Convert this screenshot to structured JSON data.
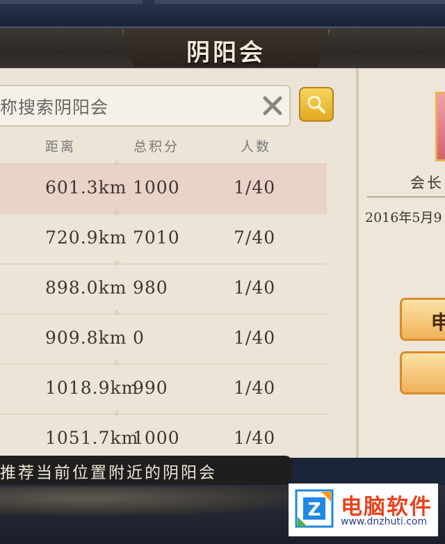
{
  "header": {
    "title": "阴阳会"
  },
  "search": {
    "text": "称搜索阴阳会"
  },
  "table": {
    "columns": [
      "距离",
      "总积分",
      "人数"
    ],
    "rows": [
      {
        "distance": "601.3km",
        "score": "1000",
        "members": "1/40"
      },
      {
        "distance": "720.9km",
        "score": "7010",
        "members": "7/40"
      },
      {
        "distance": "898.0km",
        "score": "980",
        "members": "1/40"
      },
      {
        "distance": "909.8km",
        "score": "0",
        "members": "1/40"
      },
      {
        "distance": "1018.9km",
        "score": "990",
        "members": "1/40"
      },
      {
        "distance": "1051.7km",
        "score": "1000",
        "members": "1/40"
      }
    ]
  },
  "tip": {
    "text": "推荐当前位置附近的阴阳会"
  },
  "detail": {
    "leader_label": "会长",
    "founded": "2016年5月9",
    "apply_label": "申"
  },
  "watermark": {
    "title": "电脑软件",
    "url": "www.dnzhuti.com"
  },
  "colors": {
    "highlight_row": "#e9d2c8",
    "accent_gold": "#e2a921",
    "panel": "#ece4d6"
  }
}
